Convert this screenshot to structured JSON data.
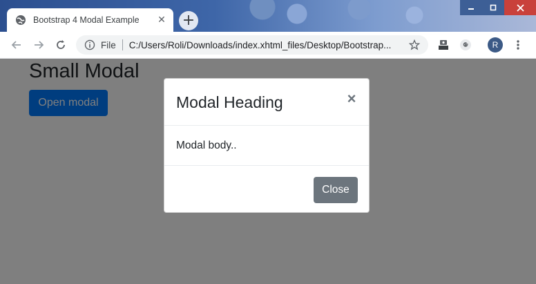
{
  "browser": {
    "tab": {
      "title": "Bootstrap 4 Modal Example",
      "favicon": "globe-icon"
    },
    "new_tab_symbol": "+",
    "window_controls": {
      "minimize": "minimize-icon",
      "maximize": "maximize-icon",
      "close": "close-icon"
    },
    "toolbar": {
      "site_info_label": "File",
      "url": "C:/Users/Roli/Downloads/index.xhtml_files/Desktop/Bootstrap...",
      "profile_initial": "R"
    }
  },
  "page": {
    "heading": "Small Modal",
    "open_button_label": "Open modal"
  },
  "modal": {
    "title": "Modal Heading",
    "close_symbol": "×",
    "body": "Modal body..",
    "footer_button_label": "Close"
  },
  "colors": {
    "primary": "#007bff",
    "secondary": "#6c757d",
    "backdrop": "rgba(0,0,0,0.5)"
  }
}
